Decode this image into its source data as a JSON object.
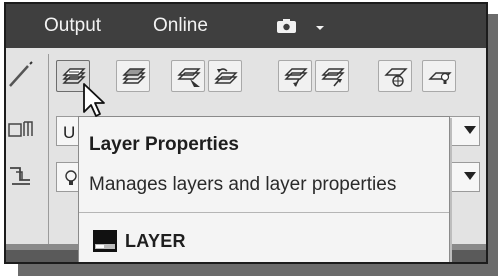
{
  "tabs": {
    "output": "Output",
    "online": "Online",
    "extra_icon": "camera-icon"
  },
  "toolbar": {
    "tools": [
      {
        "name": "layer-properties-icon"
      },
      {
        "name": "layer-states-icon"
      },
      {
        "name": "layer-match-icon"
      },
      {
        "name": "layer-previous-icon"
      },
      {
        "name": "layer-isolate-icon"
      },
      {
        "name": "layer-unisolate-icon"
      },
      {
        "name": "layer-freeze-icon"
      },
      {
        "name": "layer-off-icon"
      }
    ],
    "layer_combo_value": "U",
    "second_combo_icon": "bulb-icon"
  },
  "tooltip": {
    "title": "Layer Properties",
    "description": "Manages layers and layer properties",
    "command": "LAYER",
    "command_icon": "command-line-icon"
  },
  "colors": {
    "tabbar": "#3f3f3f",
    "ribbon": "#e3e3e3",
    "tooltip_bg": "#f4f4f4"
  }
}
